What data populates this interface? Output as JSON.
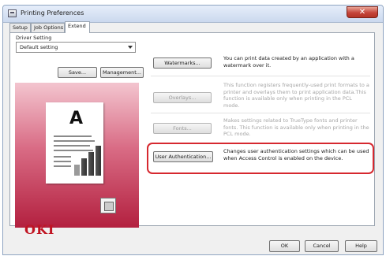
{
  "window": {
    "title": "Printing Preferences",
    "close_label": "✕"
  },
  "tabs": [
    {
      "label": "Setup"
    },
    {
      "label": "Job Options"
    },
    {
      "label": "Extend"
    }
  ],
  "driver_setting": {
    "label": "Driver Setting",
    "selected": "Default setting",
    "save_label": "Save...",
    "management_label": "Management..."
  },
  "preview": {
    "letter": "A"
  },
  "functions": [
    {
      "button": "Watermarks...",
      "description": "You can print data created by an application with a watermark over it."
    },
    {
      "button": "Overlays...",
      "description": "This function registers frequently-used print formats to a printer and overlays them to print application data.This function is available only when printing in the PCL mode."
    },
    {
      "button": "Fonts...",
      "description": "Makes settings related to TrueType fonts and printer fonts. This function is available only when printing in the PCL mode."
    },
    {
      "button": "User Authentication...",
      "description": "Changes user authentication settings which can be used when Access Control is enabled on the device."
    }
  ],
  "brand": {
    "logo": "OKI",
    "color": "#c01422"
  },
  "footer": {
    "ok_label": "OK",
    "cancel_label": "Cancel",
    "help_label": "Help"
  },
  "colors": {
    "highlight": "#d6282f",
    "preview_top": "#f3c5cf",
    "preview_bottom": "#b3203f"
  }
}
